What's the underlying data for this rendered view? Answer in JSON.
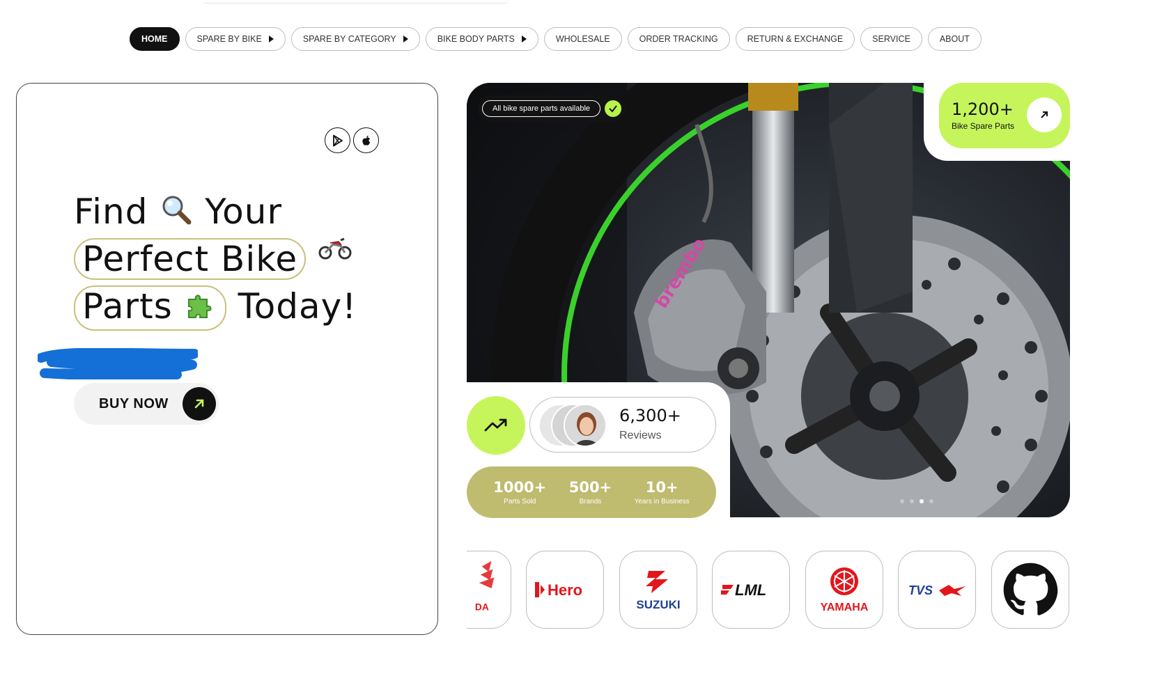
{
  "nav": {
    "items": [
      {
        "label": "HOME",
        "active": true,
        "has_submenu": false
      },
      {
        "label": "SPARE BY BIKE",
        "active": false,
        "has_submenu": true
      },
      {
        "label": "SPARE BY CATEGORY",
        "active": false,
        "has_submenu": true
      },
      {
        "label": "BIKE BODY PARTS",
        "active": false,
        "has_submenu": true
      },
      {
        "label": "WHOLESALE",
        "active": false,
        "has_submenu": false
      },
      {
        "label": "ORDER TRACKING",
        "active": false,
        "has_submenu": false
      },
      {
        "label": "RETURN & EXCHANGE",
        "active": false,
        "has_submenu": false
      },
      {
        "label": "SERVICE",
        "active": false,
        "has_submenu": false
      },
      {
        "label": "ABOUT",
        "active": false,
        "has_submenu": false
      }
    ]
  },
  "hero": {
    "store_icons": [
      "google-play-icon",
      "apple-icon"
    ],
    "headline": {
      "line1_a": "Find",
      "line1_b": "Your",
      "line2": "Perfect Bike",
      "line3_a": "Parts",
      "line3_b": "Today!"
    },
    "emojis": {
      "line1": "magnifier-icon",
      "line2": "motorbike-icon",
      "line3": "puzzle-icon"
    },
    "buy_label": "BUY NOW"
  },
  "showcase": {
    "availability": "All bike spare parts available",
    "parts_count": "1,200+",
    "parts_label": "Bike Spare Parts",
    "reviews_count": "6,300+",
    "reviews_label": "Reviews",
    "stats": [
      {
        "value": "1000+",
        "label": "Parts Sold"
      },
      {
        "value": "500+",
        "label": "Brands"
      },
      {
        "value": "10+",
        "label": "Years in Business"
      }
    ],
    "slider_dots": 4,
    "slider_active": 2
  },
  "brands": [
    {
      "name": "Honda",
      "text": "DA"
    },
    {
      "name": "Hero",
      "text": "Hero"
    },
    {
      "name": "Suzuki",
      "text": "SUZUKI"
    },
    {
      "name": "LML",
      "text": "LML"
    },
    {
      "name": "Yamaha",
      "text": "YAMAHA"
    },
    {
      "name": "TVS",
      "text": "TVS"
    },
    {
      "name": "GitHub",
      "text": ""
    }
  ],
  "colors": {
    "lime": "#c5f55a",
    "olive": "#bfbb6f",
    "dark": "#111111",
    "brand_red": "#e3161b",
    "suzuki_blue": "#1c3f95",
    "tvs_blue": "#20409a"
  }
}
